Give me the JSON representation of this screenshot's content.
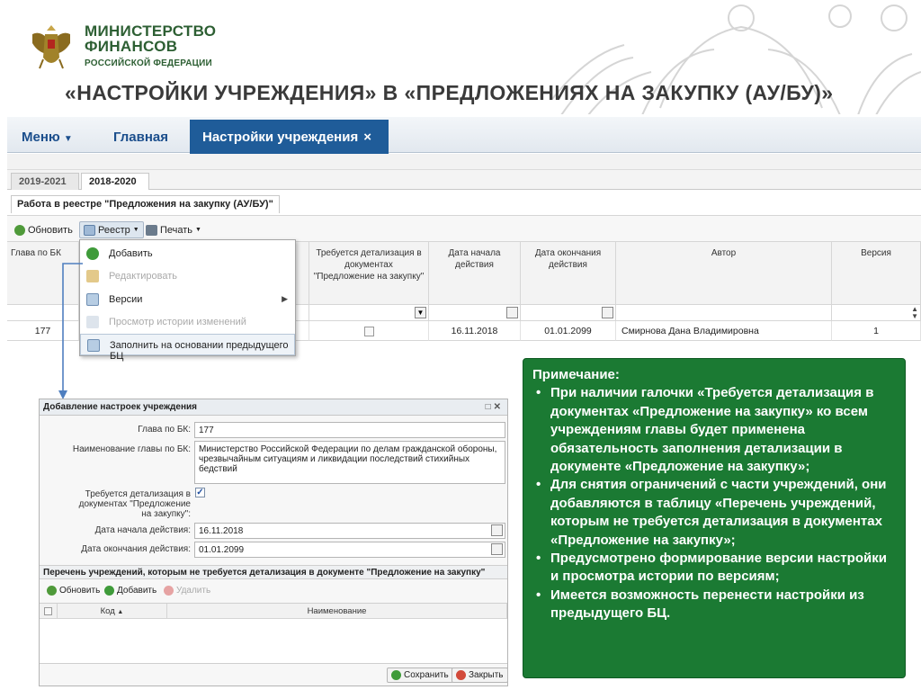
{
  "slide": {
    "ministry_line1": "МИНИСТЕРСТВО",
    "ministry_line2": "ФИНАНСОВ",
    "ministry_line3": "РОССИЙСКОЙ ФЕДЕРАЦИИ",
    "title": "«НАСТРОЙКИ УЧРЕЖДЕНИЯ» В «ПРЕДЛОЖЕНИЯХ НА ЗАКУПКУ (АУ/БУ)»"
  },
  "topnav": {
    "menu_label": "Меню",
    "main_label": "Главная",
    "active_tab_label": "Настройки учреждения",
    "active_tab_close": "×"
  },
  "year_tabs": [
    {
      "label": "2019-2021"
    },
    {
      "label": "2018-2020"
    }
  ],
  "register_title": "Работа в реестре \"Предложения на закупку (АУ/БУ)\"",
  "toolbar": {
    "refresh": "Обновить",
    "registry": "Реестр",
    "print": "Печать"
  },
  "grid": {
    "columns": [
      "Глава по БК",
      "Требуется детализация в документах \"Предложение на закупку\"",
      "Дата начала действия",
      "Дата окончания действия",
      "Автор",
      "Версия"
    ],
    "row": {
      "glava": "177",
      "start": "16.11.2018",
      "end": "01.01.2099",
      "author": "Смирнова Дана Владимировна",
      "version": "1"
    }
  },
  "registry_menu": {
    "items": [
      {
        "label": "Добавить",
        "enabled": true
      },
      {
        "label": "Редактировать",
        "enabled": false
      },
      {
        "label": "Версии",
        "enabled": true
      },
      {
        "label": "Просмотр истории изменений",
        "enabled": false
      },
      {
        "label": "Заполнить на основании предыдущего БЦ",
        "enabled": true
      }
    ]
  },
  "dialog": {
    "title": "Добавление настроек учреждения",
    "glava_label": "Глава по БК:",
    "glava_value": "177",
    "name_label": "Наименование главы по БК:",
    "name_value": "Министерство Российской Федерации по делам гражданской обороны, чрезвычайным ситуациям и ликвидации последствий стихийных бедствий",
    "detail_label": "Требуется детализация в документах \"Предложение на закупку\":",
    "detail_checked": true,
    "start_label": "Дата начала действия:",
    "start_value": "16.11.2018",
    "end_label": "Дата окончания действия:",
    "end_value": "01.01.2099",
    "section_title": "Перечень учреждений, которым не требуется детализация в документе \"Предложение на закупку\"",
    "tool_refresh": "Обновить",
    "tool_add": "Добавить",
    "tool_delete": "Удалить",
    "col_code": "Код",
    "col_name": "Наименование",
    "save": "Сохранить",
    "close": "Закрыть"
  },
  "note": {
    "heading": "Примечание:",
    "items": [
      "При наличии галочки «Требуется детализация в документах «Предложение на закупку» ко всем учреждениям главы будет применена обязательность заполнения детализации в документе «Предложение на закупку»;",
      "Для снятия ограничений с части учреждений, они добавляются в таблицу «Перечень учреждений, которым не требуется детализация в документах «Предложение на закупку»;",
      "Предусмотрено формирование версии настройки и просмотра истории по версиям;",
      "Имеется возможность перенести настройки из предыдущего БЦ."
    ]
  },
  "colors": {
    "brand_green": "#2d5f33",
    "note_green": "#1b7a33",
    "tab_blue": "#1f5c99"
  }
}
